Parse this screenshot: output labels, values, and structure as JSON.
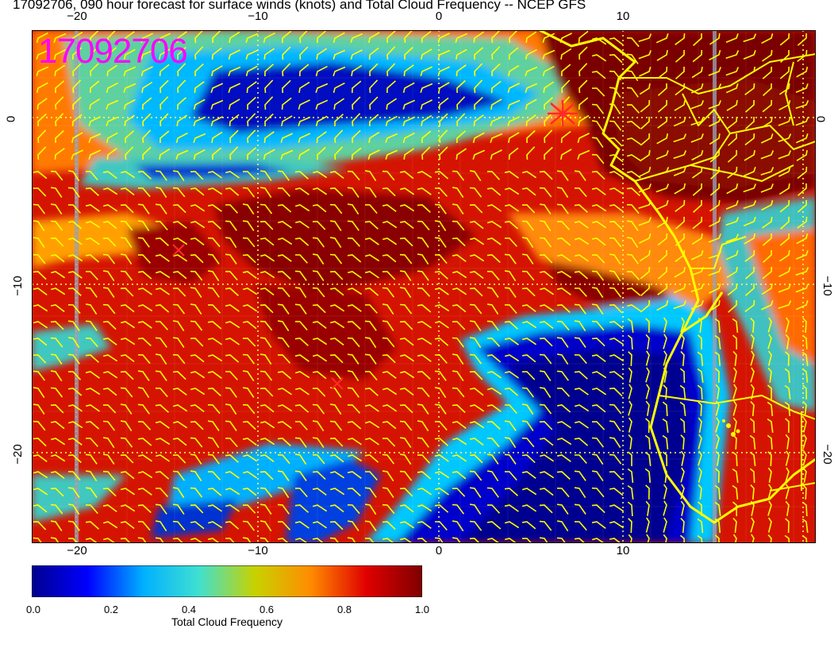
{
  "title": "17092706, 090 hour forecast for surface winds (knots) and Total Cloud Frequency -- NCEP GFS",
  "stamp": "17092706",
  "axes": {
    "top": [
      "−20",
      "−10",
      "0",
      "10"
    ],
    "bottom": [
      "−20",
      "−10",
      "0",
      "10"
    ],
    "left": [
      "0",
      "−10",
      "−20"
    ],
    "right": [
      "0",
      "−10",
      "−20"
    ]
  },
  "colorbar": {
    "title": "Total Cloud Frequency",
    "labels": [
      "0.0",
      "0.2",
      "0.4",
      "0.6",
      "0.8",
      "1.0"
    ],
    "stops": [
      "#00008f",
      "#0000ff",
      "#00b0ff",
      "#40e0d0",
      "#c8d200",
      "#ff8c00",
      "#e00000",
      "#7f0000"
    ]
  },
  "colors": {
    "stamp": "#ff00ff",
    "coast": "#ffff00",
    "barb": "#ffff00",
    "marker": "#ff2a2a",
    "grid": "#ffff66"
  }
}
